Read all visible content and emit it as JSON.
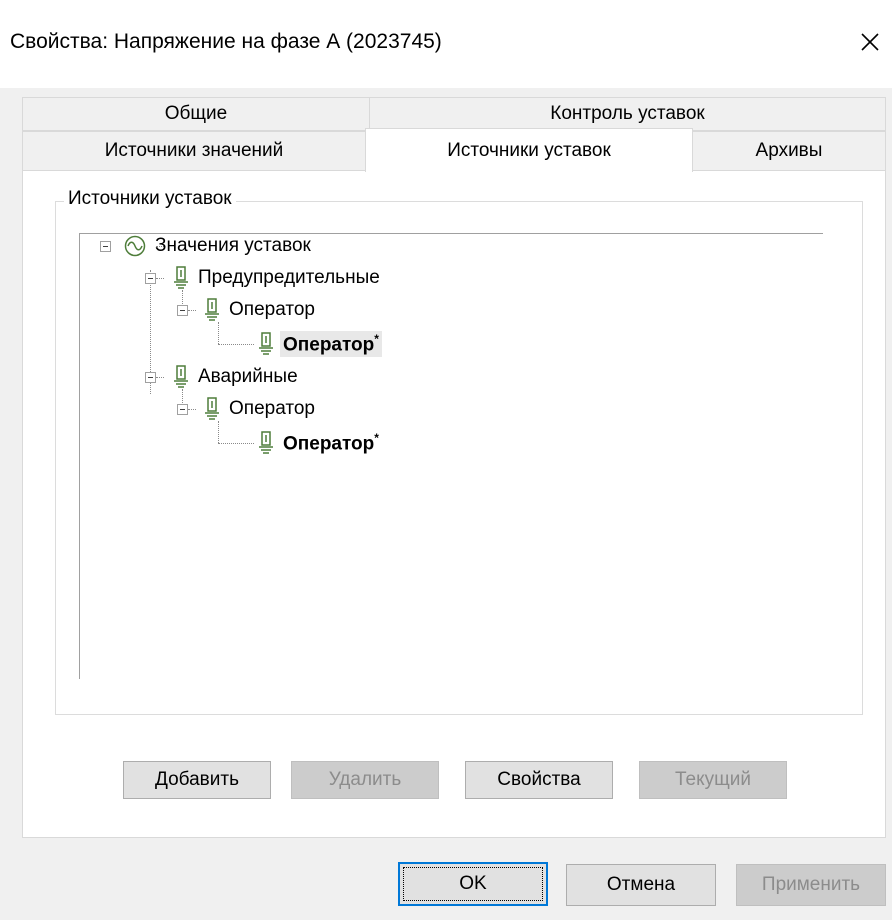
{
  "window": {
    "title": "Свойства: Напряжение на фазе А (2023745)",
    "close_icon": "close-icon"
  },
  "tabs": {
    "row1": [
      "Общие",
      "Контроль уставок"
    ],
    "row2": [
      "Источники значений",
      "Источники уставок",
      "Архивы"
    ],
    "active": "Источники уставок"
  },
  "group": {
    "title": "Источники уставок"
  },
  "tree": {
    "root": {
      "label": "Значения уставок",
      "icon": "sine-wave-icon"
    },
    "warning": {
      "label": "Предупредительные",
      "icon": "setpoint-icon"
    },
    "warning_operator": {
      "label": "Оператор",
      "icon": "setpoint-icon"
    },
    "warning_operator_current": {
      "label": "Оператор",
      "marker": "*",
      "icon": "setpoint-icon",
      "selected": true
    },
    "alarm": {
      "label": "Аварийные",
      "icon": "setpoint-icon"
    },
    "alarm_operator": {
      "label": "Оператор",
      "icon": "setpoint-icon"
    },
    "alarm_operator_current": {
      "label": "Оператор",
      "marker": "*",
      "icon": "setpoint-icon"
    }
  },
  "buttons": {
    "add": "Добавить",
    "delete": "Удалить",
    "properties": "Свойства",
    "current": "Текущий"
  },
  "dialog_buttons": {
    "ok": "OK",
    "cancel": "Отмена",
    "apply": "Применить"
  },
  "colors": {
    "icon_green": "#4e7d3a",
    "default_button_border": "#0078d7",
    "disabled_text": "#8c8c8c"
  }
}
